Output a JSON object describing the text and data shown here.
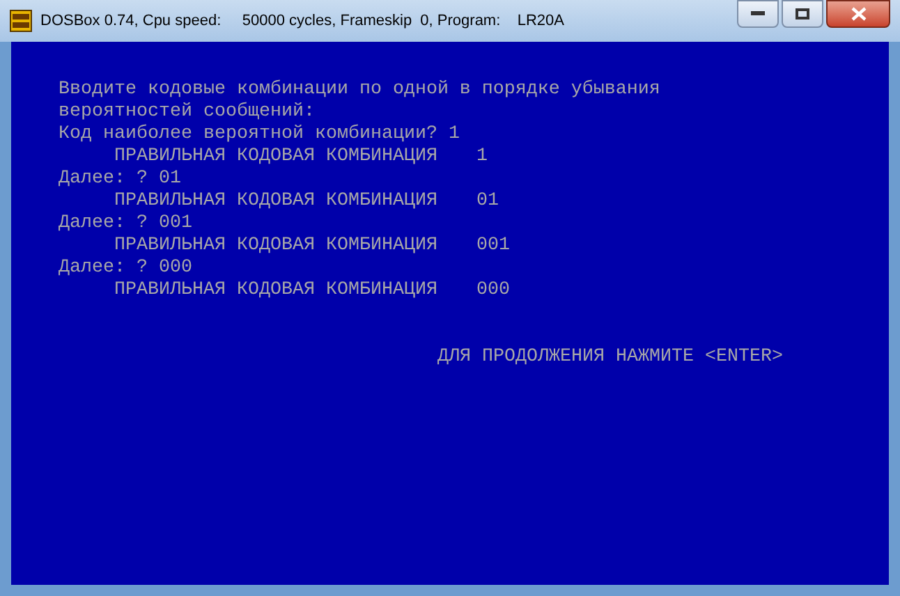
{
  "window": {
    "title": "DOSBox 0.74, Cpu speed:     50000 cycles, Frameskip  0, Program:    LR20A"
  },
  "console": {
    "lines": [
      {
        "kind": "plain",
        "text": "Вводите кодовые комбинации по одной в порядке убывания"
      },
      {
        "kind": "plain",
        "text": "вероятностей сообщений:"
      },
      {
        "kind": "input",
        "text": "Код наиболее вероятной комбинации?",
        "value": "1"
      },
      {
        "kind": "result",
        "text": "ПРАВИЛЬНАЯ КОДОВАЯ КОМБИНАЦИЯ",
        "value": "1"
      },
      {
        "kind": "input",
        "text": "Далее: ?",
        "value": "01"
      },
      {
        "kind": "result",
        "text": "ПРАВИЛЬНАЯ КОДОВАЯ КОМБИНАЦИЯ",
        "value": "01"
      },
      {
        "kind": "input",
        "text": "Далее: ?",
        "value": "001"
      },
      {
        "kind": "result",
        "text": "ПРАВИЛЬНАЯ КОДОВАЯ КОМБИНАЦИЯ",
        "value": "001"
      },
      {
        "kind": "input",
        "text": "Далее: ?",
        "value": "000"
      },
      {
        "kind": "result",
        "text": "ПРАВИЛЬНАЯ КОДОВАЯ КОМБИНАЦИЯ",
        "value": "000"
      }
    ],
    "continue_prompt": "ДЛЯ ПРОДОЛЖЕНИЯ НАЖМИТЕ <ENTER>"
  }
}
